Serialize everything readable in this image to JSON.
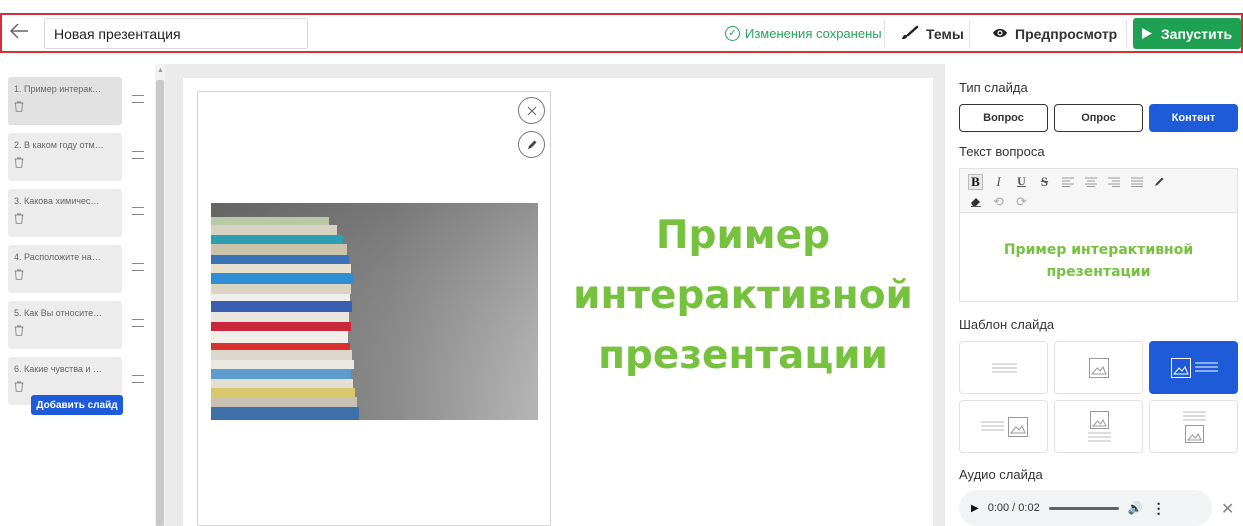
{
  "topbar": {
    "title_value": "Новая презентация",
    "saved_status": "Изменения сохранены",
    "themes_label": "Темы",
    "preview_label": "Предпросмотр",
    "run_label": "Запустить",
    "accent_color": "#1fa154",
    "highlight_color": "#d62f37"
  },
  "sidebar": {
    "slides": [
      {
        "label": "1. Пример интерак…"
      },
      {
        "label": "2. В каком году отм…"
      },
      {
        "label": "3. Какова химичес…"
      },
      {
        "label": "4. Расположите на…"
      },
      {
        "label": "5. Как Вы относите…"
      },
      {
        "label": "6. Какие чувства и …"
      }
    ],
    "add_slide_label": "Добавить слайд"
  },
  "canvas": {
    "heading": "Пример интерактивной презентации",
    "heading_color": "#76c13e"
  },
  "panel": {
    "slide_type_label": "Тип слайда",
    "slide_types": [
      "Вопрос",
      "Опрос",
      "Контент"
    ],
    "active_type": "Контент",
    "question_text_label": "Текст вопроса",
    "editor_text": "Пример интерактивной презентации",
    "template_label": "Шаблон слайда",
    "audio_label": "Аудио слайда",
    "audio_time": "0:00 / 0:02",
    "primary_color": "#1e5bd8"
  }
}
